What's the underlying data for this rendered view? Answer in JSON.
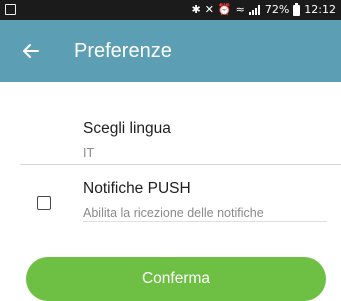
{
  "status_bar": {
    "battery_percent": "72%",
    "time": "12:12",
    "icons": [
      "gallery-icon",
      "bluetooth-icon",
      "mute-icon",
      "alarm-icon",
      "wifi-icon",
      "signal-icon",
      "battery-icon"
    ]
  },
  "app_bar": {
    "title": "Preferenze",
    "back_icon": "arrow-left-icon",
    "background_color": "#5c9fb5"
  },
  "settings": {
    "language": {
      "title": "Scegli lingua",
      "value": "IT"
    },
    "push": {
      "title": "Notifiche PUSH",
      "subtitle": "Abilita la ricezione delle notifiche",
      "checked": false
    }
  },
  "confirm_button": {
    "label": "Conferma",
    "color": "#6dc043"
  }
}
